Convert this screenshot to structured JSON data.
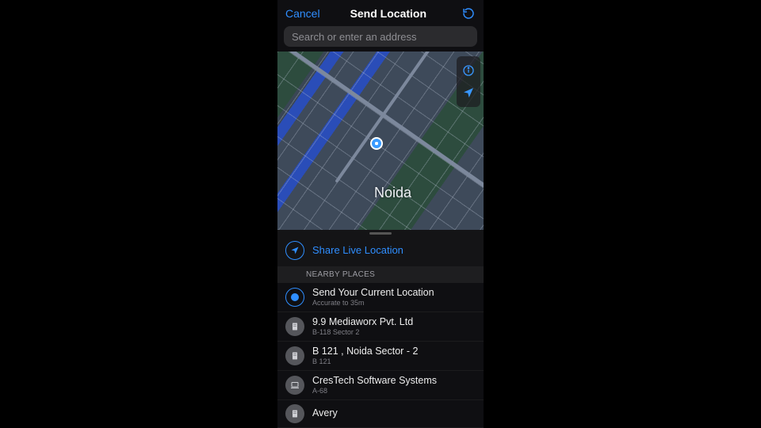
{
  "header": {
    "cancel_label": "Cancel",
    "title": "Send Location"
  },
  "search": {
    "placeholder": "Search or enter an address"
  },
  "map": {
    "city_label": "Noida"
  },
  "share_live": {
    "label": "Share Live Location"
  },
  "section_header": "NEARBY PLACES",
  "current_location": {
    "title": "Send Your Current Location",
    "subtitle": "Accurate to 35m"
  },
  "places": [
    {
      "name": "9.9 Mediaworx Pvt. Ltd",
      "addr": "B-118 Sector 2",
      "icon": "building"
    },
    {
      "name": "B 121 , Noida Sector - 2",
      "addr": "B 121",
      "icon": "building"
    },
    {
      "name": "CresTech Software Systems",
      "addr": "A-68",
      "icon": "laptop"
    },
    {
      "name": "Avery",
      "addr": "",
      "icon": "building"
    }
  ]
}
